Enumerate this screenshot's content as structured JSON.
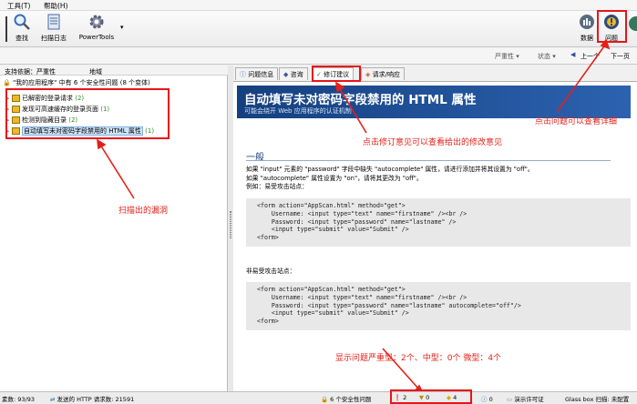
{
  "menu": [
    "工具(T)",
    "帮助(H)"
  ],
  "toolbar": {
    "left": [
      {
        "label": "查找",
        "icon": "magnifier-icon"
      },
      {
        "label": "扫描日志",
        "icon": "scan-log-icon"
      },
      {
        "label": "PowerTools",
        "icon": "gear-icon"
      }
    ],
    "right": [
      {
        "label": "数据",
        "icon": "data-icon"
      },
      {
        "label": "问题",
        "icon": "issues-icon"
      }
    ]
  },
  "filterbar": {
    "severity": "严重性",
    "status": "状态",
    "prev": "上一个",
    "next": "下一页"
  },
  "left": {
    "header": {
      "sortby": "支持依据：",
      "col1": "严重性",
      "col2": "地域"
    },
    "root": "\"我的应用程序\" 中有 6 个安全性问题 (8 个变体)",
    "items": [
      {
        "label": "已解密的登录请求",
        "count": "(2)"
      },
      {
        "label": "发现可高速缓存的登录页面",
        "count": "(1)"
      },
      {
        "label": "检测到隐藏目录",
        "count": "(2)"
      },
      {
        "label": "自动填写未对密码字段禁用的 HTML 属性",
        "count": "(1)"
      }
    ]
  },
  "tabs": [
    "问题信息",
    "咨询",
    "修订建议",
    "请求/响应"
  ],
  "detail": {
    "title": "自动填写未对密码字段禁用的 HTML 属性",
    "subtitle": "可能会绕开 Web 应用程序的认证机制",
    "section": "一般",
    "desc1": "如果 \"input\" 元素的 \"password\" 字段中缺失 \"autocomplete\" 属性，请进行添加并将其设置为 \"off\"。",
    "desc2": "如果 \"autocomplete\" 属性设置为 \"on\"，请将其更改为 \"off\"。",
    "example": "例如：易受攻击站点：",
    "code1": [
      "<form action=\"AppScan.html\" method=\"get\">",
      "    Username: <input type=\"text\" name=\"firstname\" /><br />",
      "    Password: <input type=\"password\" name=\"lastname\" />",
      "    <input type=\"submit\" value=\"Submit\" />",
      "<form>"
    ],
    "nonvuln": "非易受攻击站点：",
    "code2": [
      "<form action=\"AppScan.html\" method=\"get\">",
      "    Username: <input type=\"text\" name=\"firstname\" /><br />",
      "    Password: <input type=\"password\" name=\"lastname\" autocomplete=\"off\"/>",
      "    <input type=\"submit\" value=\"Submit\" />",
      "<form>"
    ]
  },
  "annotations": {
    "issues": "点击问题可以查看详细",
    "fix": "点击修订意见可以查看给出的修改意见",
    "scanned": "扫描出的漏洞",
    "severity": "显示问题严重型：2个、中型：0个  微型：4个"
  },
  "status": {
    "visited": "素数: 93/93",
    "requests": "发送的 HTTP 请求数: 21591",
    "security": "6 个安全性问题",
    "high": "2",
    "medium": "0",
    "low": "4",
    "info": "0",
    "license": "演示许可证",
    "glassbox": "Glass box 扫描: 未配置"
  },
  "colors": {
    "annotation": "#e3211a",
    "title_bg": "#1f4f99",
    "code_bg": "#e8e8e8"
  }
}
